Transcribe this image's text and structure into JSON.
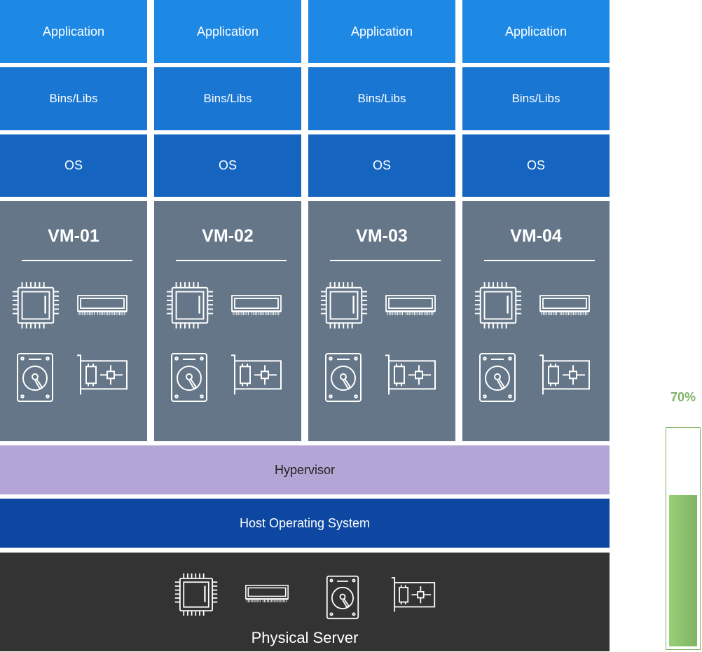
{
  "vms": [
    {
      "name": "VM-01",
      "app": "Application",
      "bins": "Bins/Libs",
      "os": "OS"
    },
    {
      "name": "VM-02",
      "app": "Application",
      "bins": "Bins/Libs",
      "os": "OS"
    },
    {
      "name": "VM-03",
      "app": "Application",
      "bins": "Bins/Libs",
      "os": "OS"
    },
    {
      "name": "VM-04",
      "app": "Application",
      "bins": "Bins/Libs",
      "os": "OS"
    }
  ],
  "vm_icons": [
    "cpu-icon",
    "ram-icon",
    "hard-drive-icon",
    "network-card-icon"
  ],
  "layers": {
    "hypervisor": "Hypervisor",
    "host_os": "Host Operating System",
    "physical_server": "Physical Server"
  },
  "physical_icons": [
    "cpu-icon",
    "ram-icon",
    "hard-drive-icon",
    "network-card-icon"
  ],
  "progress": {
    "label": "70%",
    "value": 0.7,
    "color": "#82b366"
  },
  "colors": {
    "application": "#1e88e5",
    "bins_libs": "#1976d2",
    "os": "#1565c0",
    "vm": "#647687",
    "hypervisor": "#b3a6d6",
    "host_os": "#0d47a1",
    "physical_server": "#333333"
  }
}
